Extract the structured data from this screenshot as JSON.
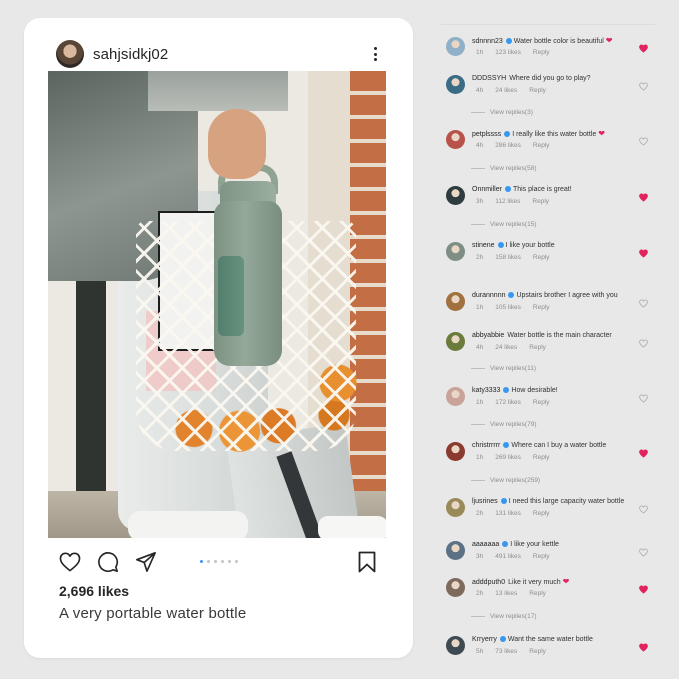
{
  "post": {
    "username": "sahjsidkj02",
    "likes": "2,696 likes",
    "caption": "A very portable water bottle",
    "carousel": {
      "count": 6,
      "active_index": 0
    },
    "colors": {
      "accent": "#3897f0",
      "heart": "#e0245e",
      "background": "#e8e8e8"
    },
    "icons": [
      "more-icon",
      "heart-icon",
      "comment-icon",
      "share-icon",
      "bookmark-icon"
    ]
  },
  "comments": [
    {
      "user": "sdnnnn23",
      "verified": true,
      "text": "Water bottle color is beautiful",
      "emoji": "❤️",
      "time": "1h",
      "likes": "123 likes",
      "reply": "Reply",
      "liked": true,
      "avatar_color": "#8fb0c6"
    },
    {
      "user": "DDDSSYH",
      "verified": false,
      "text": "Where did you go to play?",
      "emoji": "",
      "time": "4h",
      "likes": "24 likes",
      "reply": "Reply",
      "liked": false,
      "replies": "View replies(3)",
      "avatar_color": "#3c6b86"
    },
    {
      "user": "petplssss",
      "verified": true,
      "text": "I really like this water bottle",
      "emoji": "❤️",
      "time": "4h",
      "likes": "286 likes",
      "reply": "Reply",
      "liked": false,
      "replies": "View replies(58)",
      "avatar_color": "#b7534a"
    },
    {
      "user": "Onnmiller",
      "verified": true,
      "text": "This place is great!",
      "emoji": "",
      "time": "3h",
      "likes": "112 likes",
      "reply": "Reply",
      "liked": true,
      "replies": "View replies(15)",
      "avatar_color": "#2e3b3f"
    },
    {
      "user": "stinene",
      "verified": true,
      "text": "I like your bottle",
      "emoji": "",
      "time": "2h",
      "likes": "158 likes",
      "reply": "Reply",
      "liked": true,
      "avatar_color": "#7f8e84"
    },
    {
      "user": "durannnnn",
      "verified": true,
      "text": "Upstairs brother I agree with you",
      "emoji": "",
      "time": "1h",
      "likes": "105 likes",
      "reply": "Reply",
      "liked": false,
      "avatar_color": "#a0713f"
    },
    {
      "user": "abbyabbie",
      "verified": false,
      "text": "Water bottle is the main character",
      "emoji": "",
      "time": "4h",
      "likes": "24 likes",
      "reply": "Reply",
      "liked": false,
      "replies": "View replies(11)",
      "avatar_color": "#6a7b3c"
    },
    {
      "user": "katy3333",
      "verified": true,
      "text": "How desirable!",
      "emoji": "",
      "time": "1h",
      "likes": "172 likes",
      "reply": "Reply",
      "liked": false,
      "replies": "View replies(79)",
      "avatar_color": "#c9a39a"
    },
    {
      "user": "christrrrrr",
      "verified": true,
      "text": "Where can I buy a water bottle",
      "emoji": "",
      "time": "1h",
      "likes": "269 likes",
      "reply": "Reply",
      "liked": true,
      "replies": "View replies(259)",
      "avatar_color": "#8a3a2f"
    },
    {
      "user": "ljusrines",
      "verified": true,
      "text": "I need this large capacity water bottle",
      "emoji": "",
      "time": "2h",
      "likes": "131 likes",
      "reply": "Reply",
      "liked": false,
      "avatar_color": "#9a8a5a"
    },
    {
      "user": "aaaaaaa",
      "verified": true,
      "text": "I like your kettle",
      "emoji": "",
      "time": "3h",
      "likes": "491 likes",
      "reply": "Reply",
      "liked": false,
      "avatar_color": "#5c7183"
    },
    {
      "user": "adddputh0",
      "verified": false,
      "text": "Like it very much",
      "emoji": "❤️",
      "time": "2h",
      "likes": "13 likes",
      "reply": "Reply",
      "liked": true,
      "replies": "View replies(17)",
      "avatar_color": "#7d6a5c"
    },
    {
      "user": "Krryerry",
      "verified": true,
      "text": "Want the same water bottle",
      "emoji": "",
      "time": "5h",
      "likes": "73 likes",
      "reply": "Reply",
      "liked": true,
      "avatar_color": "#3d4a52"
    }
  ]
}
